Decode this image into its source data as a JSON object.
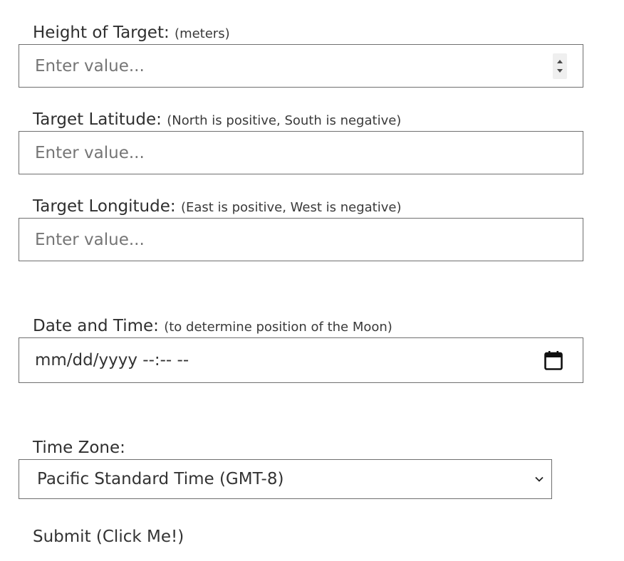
{
  "height_field": {
    "label": "Height of Target:",
    "hint": "(meters)",
    "placeholder": "Enter value..."
  },
  "latitude_field": {
    "label": "Target Latitude:",
    "hint": "(North is positive, South is negative)",
    "placeholder": "Enter value..."
  },
  "longitude_field": {
    "label": "Target Longitude:",
    "hint": "(East is positive, West is negative)",
    "placeholder": "Enter value..."
  },
  "datetime_field": {
    "label": "Date and Time:",
    "hint": "(to determine position of the Moon)",
    "value": "mm/dd/yyyy --:-- --"
  },
  "timezone_field": {
    "label": "Time Zone:",
    "selected": "Pacific Standard Time (GMT-8)"
  },
  "submit": {
    "label": "Submit (Click Me!)"
  },
  "icons": {
    "spinner": "number-spinner-icon",
    "calendar": "calendar-icon",
    "dropdown": "chevron-down-icon"
  }
}
